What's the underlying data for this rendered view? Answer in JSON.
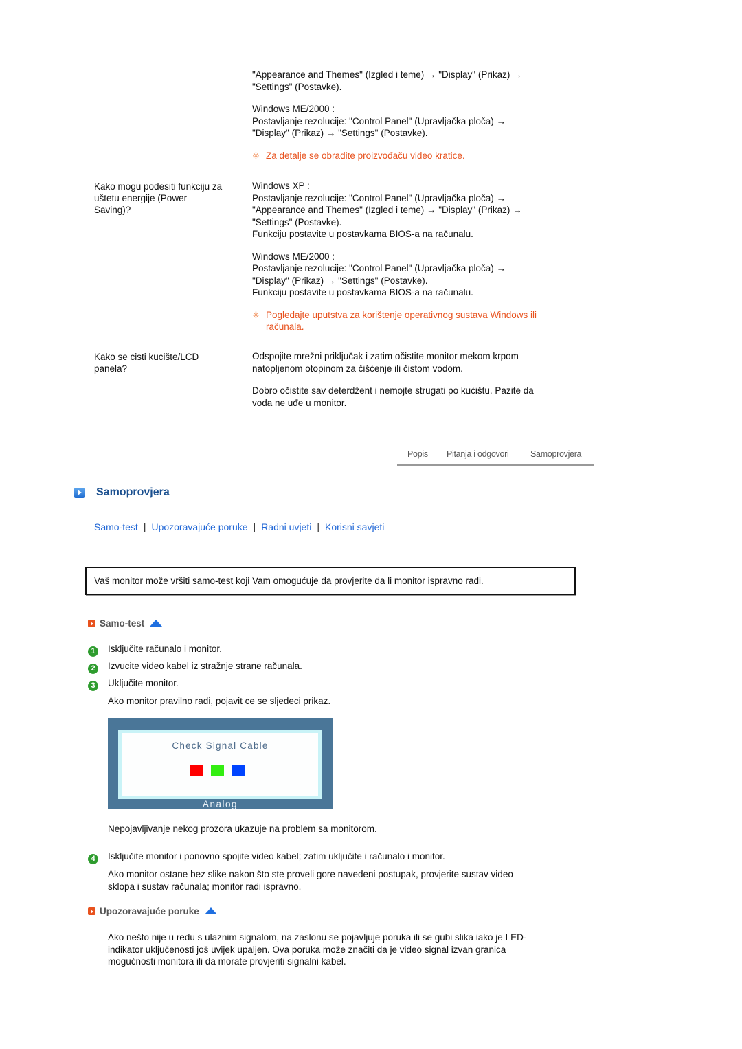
{
  "faq_continued": {
    "lines": [
      "\"Appearance and Themes\" (Izgled i teme) → \"Display\" (Prikaz) →",
      "\"Settings\" (Postavke)."
    ],
    "me2000_title": "Windows ME/2000 :",
    "me2000_lines": [
      "Postavljanje rezolucije: \"Control Panel\" (Upravljačka ploča) →",
      "\"Display\" (Prikaz) → \"Settings\" (Postavke)."
    ],
    "note": "Za detalje se obradite proizvođaču video kratice."
  },
  "faq_power": {
    "question": [
      "Kako mogu podesiti funkciju za",
      "uštetu energije (Power",
      "Saving)?"
    ],
    "xp_title": "Windows XP :",
    "xp_lines": [
      "Postavljanje rezolucije: \"Control Panel\" (Upravljačka ploča) →",
      "\"Appearance and Themes\" (Izgled i teme) → \"Display\" (Prikaz) →",
      "\"Settings\" (Postavke).",
      "Funkciju postavite u postavkama BIOS-a na računalu."
    ],
    "me2000_title": "Windows ME/2000 :",
    "me2000_lines": [
      "Postavljanje rezolucije: \"Control Panel\" (Upravljačka ploča) →",
      "\"Display\" (Prikaz) → \"Settings\" (Postavke).",
      "Funkciju postavite u postavkama BIOS-a na računalu."
    ],
    "note_lines": [
      "Pogledajte uputstva za korištenje operativnog sustava Windows ili",
      "računala."
    ]
  },
  "faq_clean": {
    "question": [
      "Kako se cisti kucište/LCD",
      "panela?"
    ],
    "answer1": [
      "Odspojite mrežni priključak i zatim očistite monitor mekom krpom",
      "natopljenom otopinom za čišćenje ili čistom vodom."
    ],
    "answer2": [
      "Dobro očistite sav deterdžent i nemojte strugati po kućištu. Pazite da",
      "voda ne uđe u monitor."
    ]
  },
  "tabs": [
    "Popis",
    "Pitanja i odgovori",
    "Samoprovjera"
  ],
  "section": {
    "title": "Samoprovjera",
    "links": [
      "Samo-test",
      "Upozoravajuće poruke",
      "Radni uvjeti",
      "Korisni savjeti"
    ],
    "intro": "Vaš monitor može vršiti samo-test koji Vam omogućuje da provjerite da li monitor ispravno radi."
  },
  "selftest": {
    "heading": "Samo-test",
    "steps": [
      {
        "num": "1",
        "text": "Isključite računalo i monitor."
      },
      {
        "num": "2",
        "text": "Izvucite video kabel iz stražnje strane računala."
      },
      {
        "num": "3",
        "text": "Uključite monitor."
      }
    ],
    "step3_note": "Ako monitor pravilno radi, pojavit ce se sljedeci prikaz.",
    "screen": {
      "message": "Check Signal Cable",
      "label": "Analog",
      "colors": [
        "#ff0000",
        "#33ee11",
        "#0044ff"
      ]
    },
    "after_screen": "Nepojavljivanje nekog prozora ukazuje na problem sa monitorom.",
    "step4": {
      "num": "4",
      "text": "Isključite monitor i ponovno spojite video kabel; zatim uključite i računalo i monitor."
    },
    "step4_note": [
      "Ako monitor ostane bez slike nakon što ste proveli gore navedeni postupak, provjerite sustav video",
      "sklopa i sustav računala; monitor radi ispravno."
    ]
  },
  "warnings": {
    "heading": "Upozoravajuće poruke",
    "lines": [
      "Ako nešto nije u redu s ulaznim signalom, na zaslonu se pojavljuje poruka ili se gubi slika iako je LED-",
      "indikator uključenosti još uvijek upaljen. Ova poruka može značiti da je video signal izvan granica",
      "mogućnosti monitora ili da morate provjeriti signalni kabel."
    ]
  }
}
